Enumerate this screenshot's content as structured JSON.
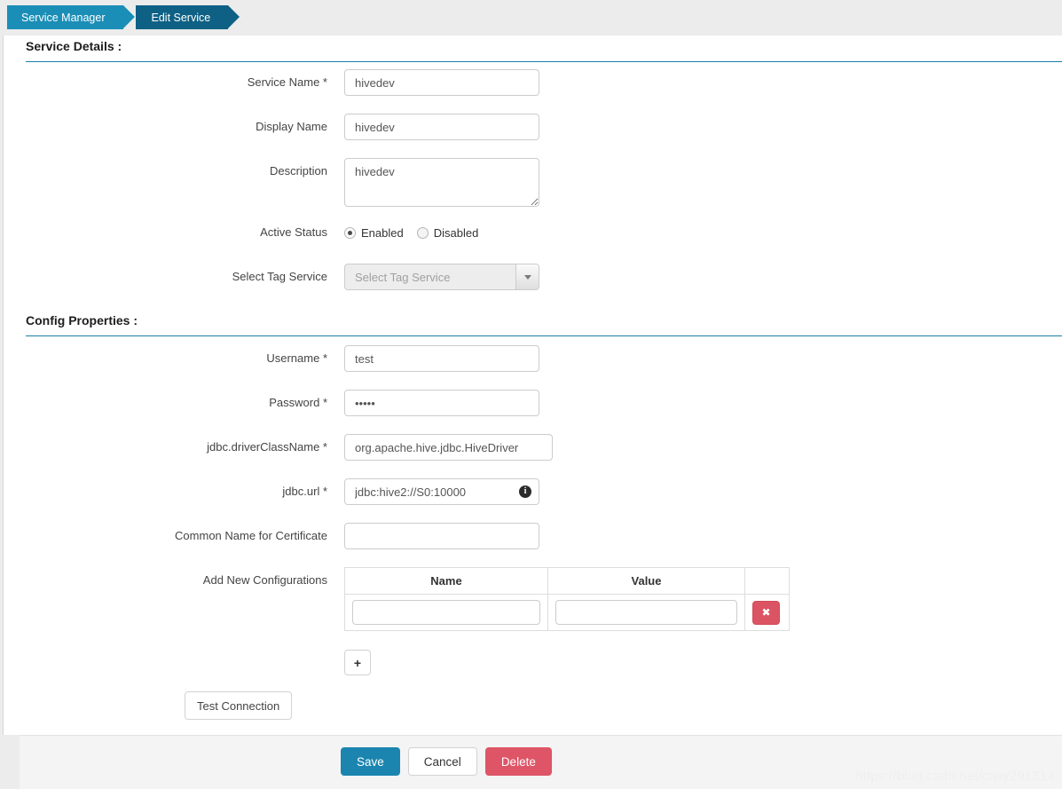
{
  "breadcrumb": {
    "items": [
      {
        "label": "Service Manager"
      },
      {
        "label": "Edit Service"
      }
    ]
  },
  "sections": {
    "service_details": {
      "title": "Service Details :"
    },
    "config_properties": {
      "title": "Config Properties :"
    }
  },
  "service_details": {
    "service_name": {
      "label": "Service Name *",
      "value": "hivedev"
    },
    "display_name": {
      "label": "Display Name",
      "value": "hivedev"
    },
    "description": {
      "label": "Description",
      "value": "hivedev"
    },
    "active_status": {
      "label": "Active Status",
      "options": [
        {
          "label": "Enabled",
          "selected": true
        },
        {
          "label": "Disabled",
          "selected": false
        }
      ]
    },
    "tag_service": {
      "label": "Select Tag Service",
      "placeholder": "Select Tag Service",
      "value": "",
      "arrow_icon": "chevron-down-icon"
    }
  },
  "config_properties": {
    "username": {
      "label": "Username *",
      "value": "test"
    },
    "password": {
      "label": "Password *",
      "value": "•••••"
    },
    "driver_class_name": {
      "label": "jdbc.driverClassName *",
      "value": "org.apache.hive.jdbc.HiveDriver"
    },
    "jdbc_url": {
      "label": "jdbc.url *",
      "value": "jdbc:hive2://S0:10000",
      "info_icon": "info-icon",
      "info_glyph": "i"
    },
    "common_name": {
      "label": "Common Name for Certificate",
      "value": ""
    },
    "add_new_configurations": {
      "label": "Add New Configurations",
      "columns": [
        "Name",
        "Value"
      ],
      "rows": [
        {
          "name": "",
          "value": "",
          "delete_icon": "close-icon",
          "delete_glyph": "✖"
        }
      ],
      "add_button_label": "+"
    },
    "test_connection_label": "Test Connection"
  },
  "footer": {
    "save_label": "Save",
    "cancel_label": "Cancel",
    "delete_label": "Delete"
  },
  "watermark": {
    "text": "https://blog.csdn.net/ctwy291314"
  },
  "colors": {
    "crumb_active": "#1b8eb7",
    "crumb_current": "#0e6185",
    "section_rule": "#1b7fa8",
    "save": "#1b85b0",
    "delete": "#dd5567",
    "page_bg": "#ececec"
  }
}
